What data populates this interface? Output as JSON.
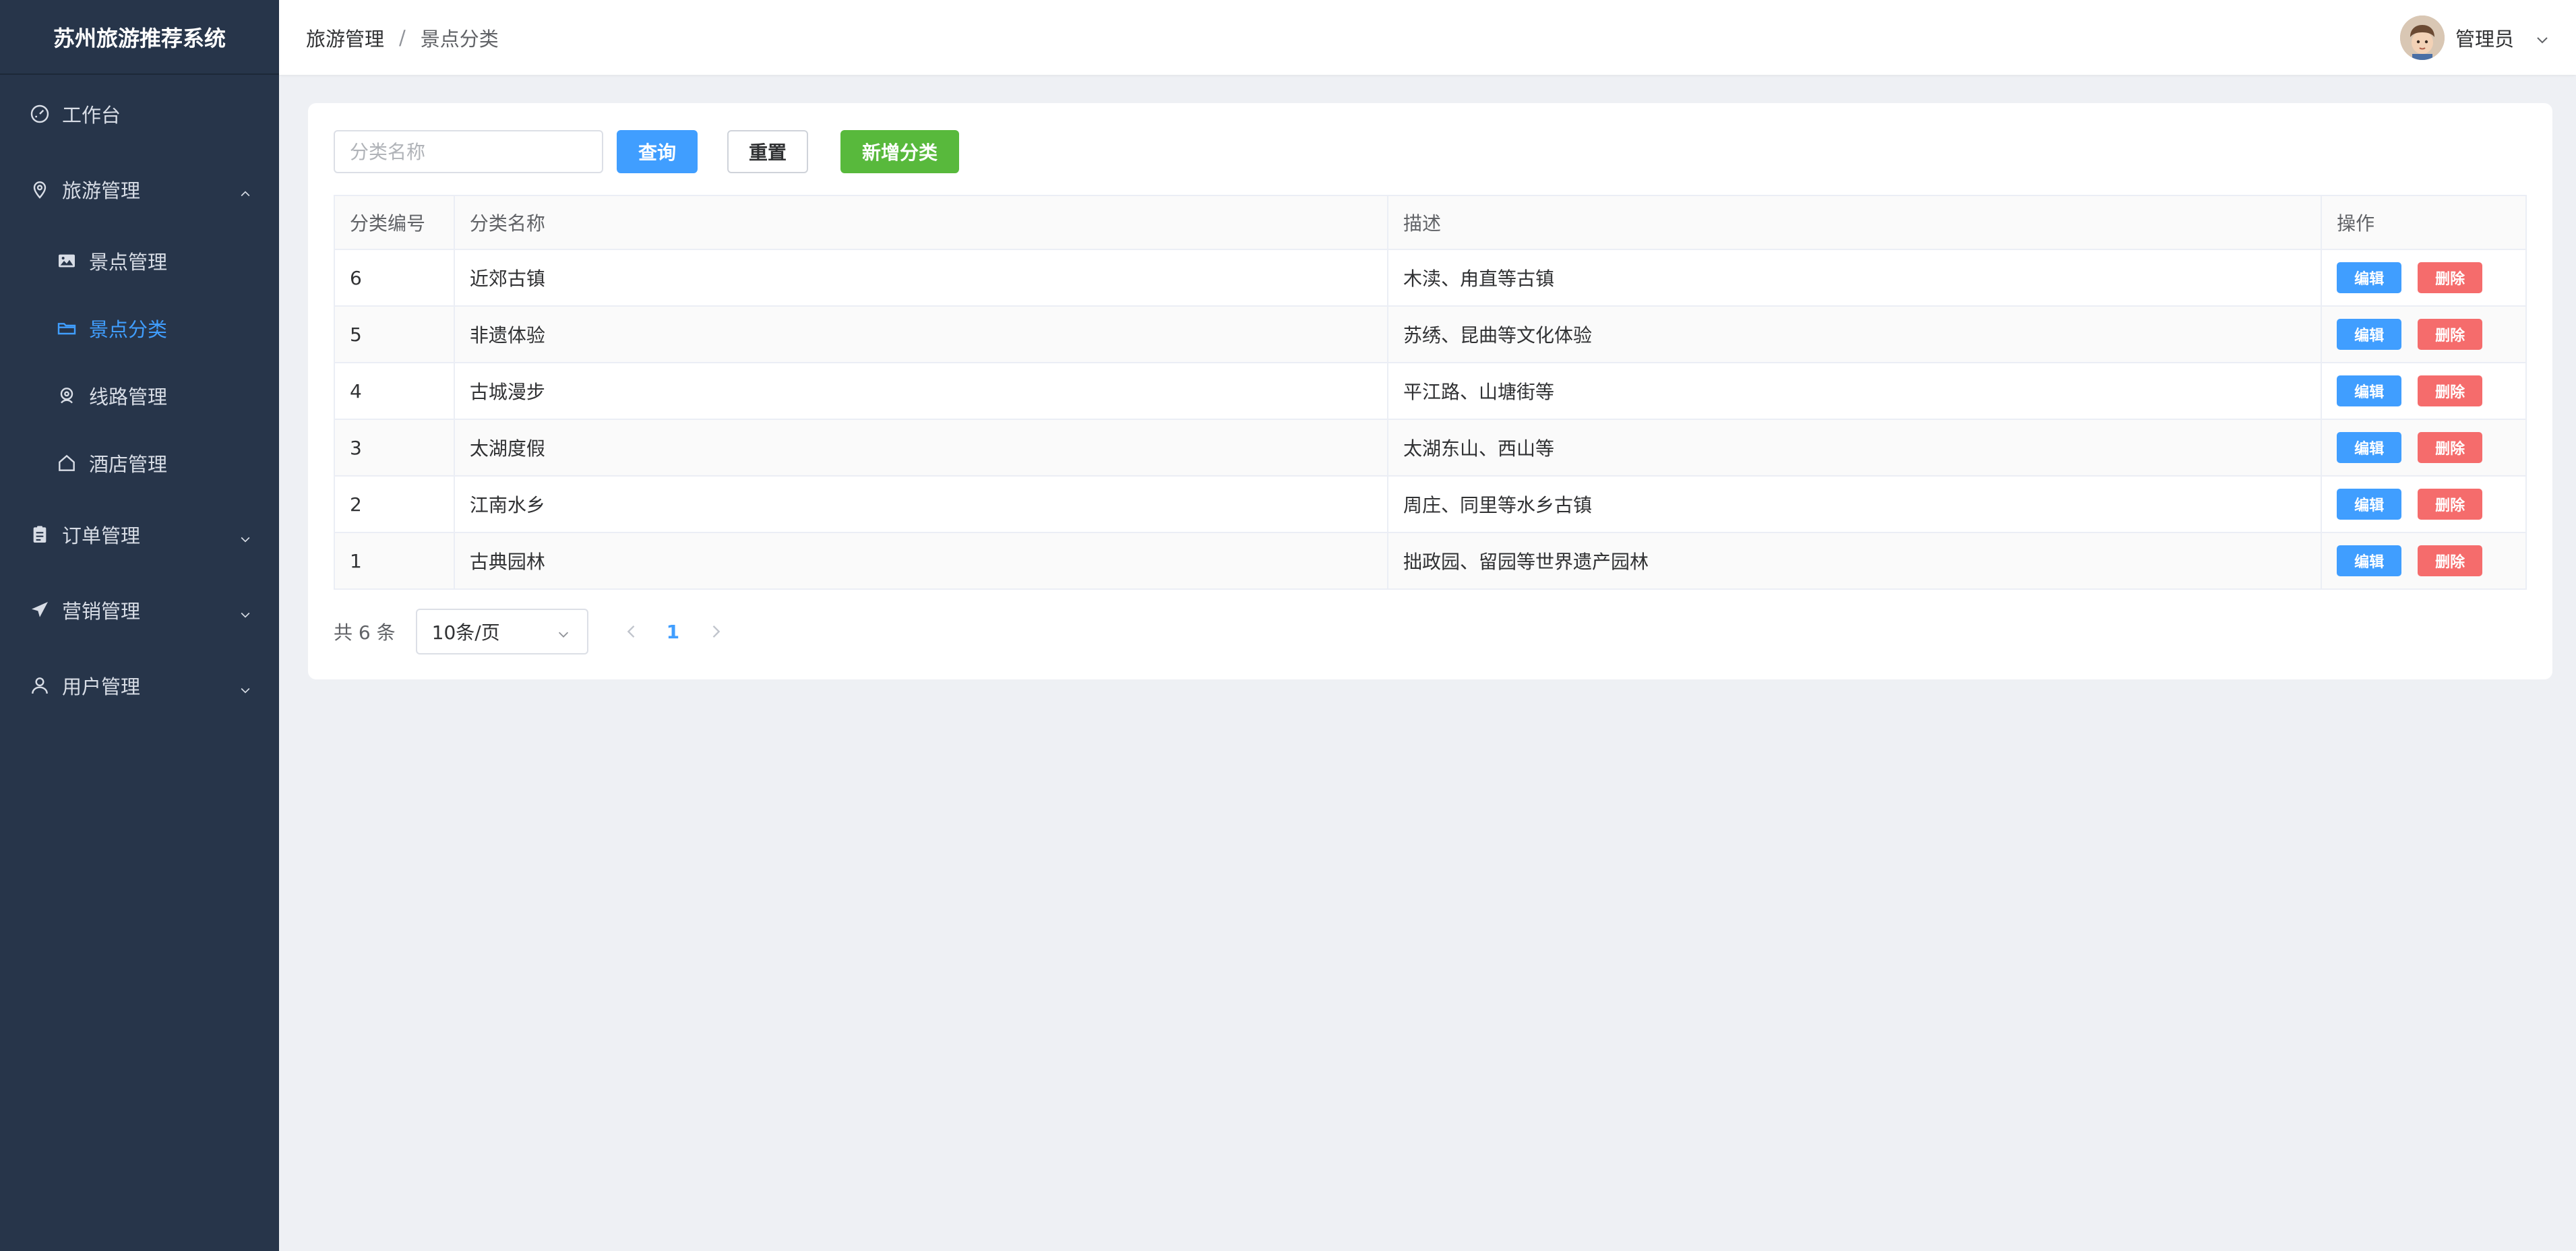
{
  "app": {
    "title": "苏州旅游推荐系统"
  },
  "sidebar": {
    "items": [
      {
        "label": "工作台",
        "icon": "dashboard-icon"
      },
      {
        "label": "旅游管理",
        "icon": "location-icon",
        "expanded": true,
        "children": [
          {
            "label": "景点管理",
            "icon": "picture-icon"
          },
          {
            "label": "景点分类",
            "icon": "folder-icon",
            "active": true
          },
          {
            "label": "线路管理",
            "icon": "map-pin-icon"
          },
          {
            "label": "酒店管理",
            "icon": "house-icon"
          }
        ]
      },
      {
        "label": "订单管理",
        "icon": "clipboard-icon",
        "expanded": false
      },
      {
        "label": "营销管理",
        "icon": "send-icon",
        "expanded": false
      },
      {
        "label": "用户管理",
        "icon": "user-icon",
        "expanded": false
      }
    ]
  },
  "header": {
    "breadcrumb": [
      "旅游管理",
      "景点分类"
    ],
    "separator": "/",
    "user": "管理员"
  },
  "toolbar": {
    "search_placeholder": "分类名称",
    "query_label": "查询",
    "reset_label": "重置",
    "add_label": "新增分类"
  },
  "table": {
    "headers": [
      "分类编号",
      "分类名称",
      "描述",
      "操作"
    ],
    "rows": [
      {
        "id": "6",
        "name": "近郊古镇",
        "desc": "木渎、甪直等古镇"
      },
      {
        "id": "5",
        "name": "非遗体验",
        "desc": "苏绣、昆曲等文化体验"
      },
      {
        "id": "4",
        "name": "古城漫步",
        "desc": "平江路、山塘街等"
      },
      {
        "id": "3",
        "name": "太湖度假",
        "desc": "太湖东山、西山等"
      },
      {
        "id": "2",
        "name": "江南水乡",
        "desc": "周庄、同里等水乡古镇"
      },
      {
        "id": "1",
        "name": "古典园林",
        "desc": "拙政园、留园等世界遗产园林"
      }
    ],
    "edit_label": "编辑",
    "delete_label": "删除"
  },
  "pagination": {
    "total_text": "共 6 条",
    "page_size": "10条/页",
    "current_page": "1"
  },
  "colors": {
    "sidebar_bg": "#27354a",
    "accent": "#409eff",
    "success": "#58b93c",
    "danger": "#f56c6c"
  }
}
